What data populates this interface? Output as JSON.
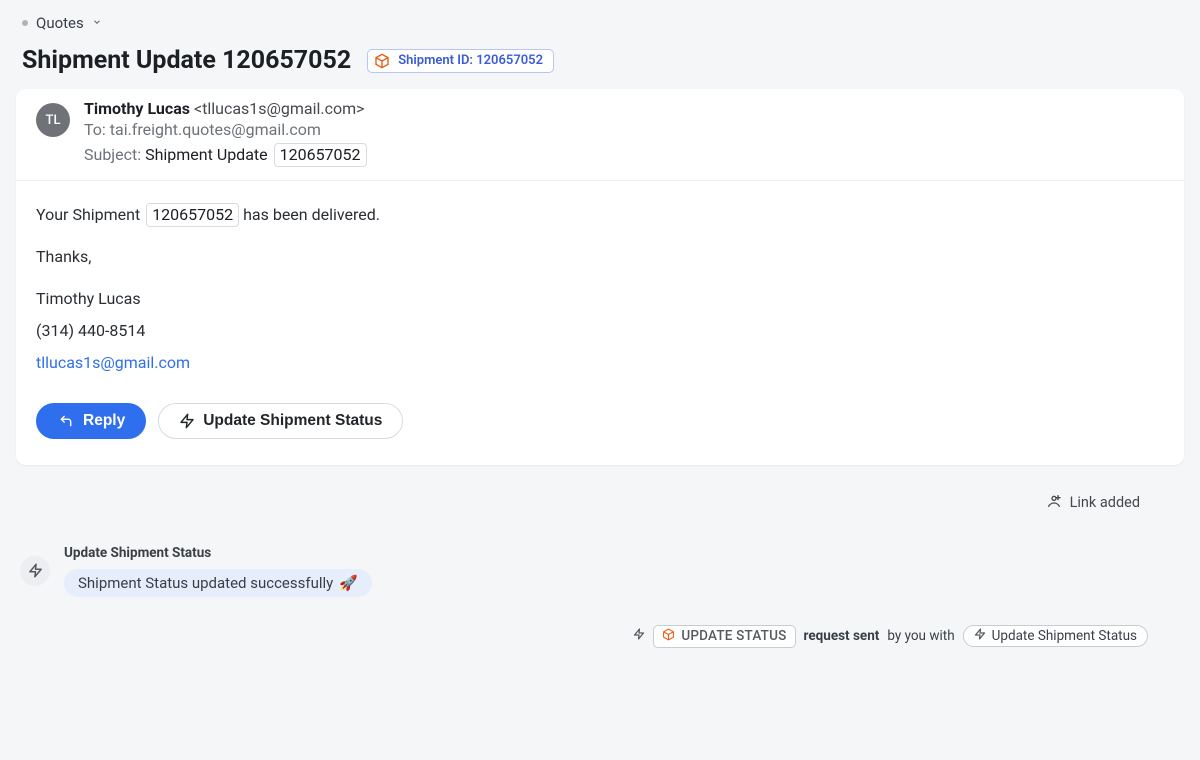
{
  "breadcrumb": {
    "label": "Quotes"
  },
  "header": {
    "title": "Shipment Update 120657052",
    "badge_label": "Shipment ID: 120657052"
  },
  "email": {
    "avatar_initials": "TL",
    "from_name": "Timothy Lucas",
    "from_email": "<tllucas1s@gmail.com>",
    "to_label": "To:",
    "to_value": "tai.freight.quotes@gmail.com",
    "subject_label": "Subject:",
    "subject_text": "Shipment Update",
    "subject_number": "120657052",
    "body_prefix": "Your Shipment",
    "body_number": "120657052",
    "body_suffix": "has been delivered.",
    "thanks": "Thanks,",
    "sig_name": "Timothy Lucas",
    "sig_phone": "(314) 440-8514",
    "sig_email": "tllucas1s@gmail.com"
  },
  "actions": {
    "reply": "Reply",
    "update_status": "Update Shipment Status"
  },
  "link_added": "Link added",
  "status": {
    "title": "Update Shipment Status",
    "message": "Shipment Status updated successfully",
    "emoji": "🚀"
  },
  "request": {
    "update_status_tag": "UPDATE STATUS",
    "sent": "request sent",
    "by_you_with": "by you with",
    "chip": "Update Shipment Status"
  }
}
